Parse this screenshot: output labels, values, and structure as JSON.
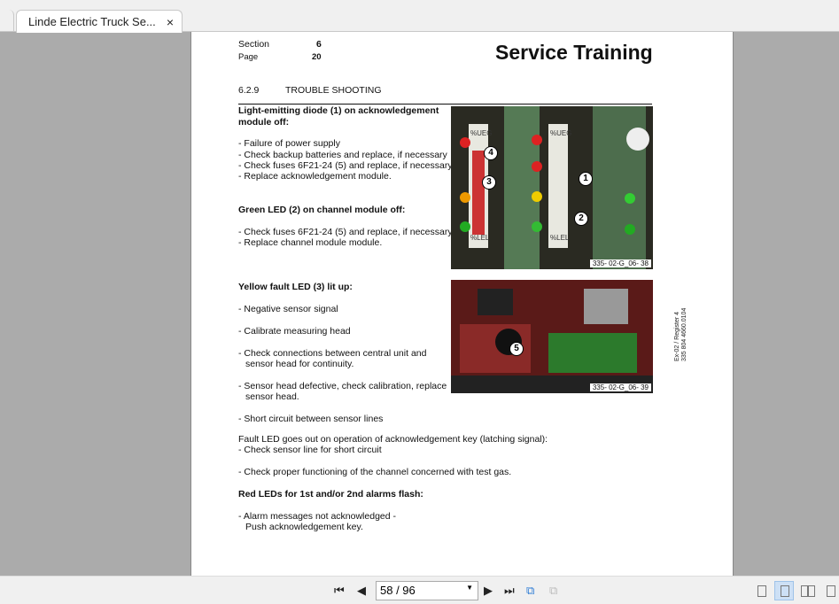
{
  "tab": {
    "title": "Linde Electric Truck Se...",
    "close": "×"
  },
  "header": {
    "section_label": "Section",
    "section_value": "6",
    "page_label": "Page",
    "page_value": "20",
    "title": "Service Training"
  },
  "heading": {
    "number": "6.2.9",
    "text": "TROUBLE  SHOOTING"
  },
  "blocks": [
    {
      "title": "Light-emitting diode (1) on acknowledgement",
      "title2": "module off:",
      "items": [
        "-  Failure of power supply",
        "-  Check backup batteries and replace, if necessary",
        "-  Check fuses 6F21-24 (5) and replace, if necessary",
        "-  Replace acknowledgement module."
      ]
    },
    {
      "title": "Green LED (2) on channel module off:",
      "items": [
        "-  Check fuses 6F21-24 (5) and replace, if necessary",
        "-  Replace channel module module."
      ]
    },
    {
      "title": "Yellow fault LED (3) lit up:",
      "items": [
        "-  Negative sensor signal",
        "-  Calibrate measuring head",
        "-  Check  connections  between  central  unit  and",
        "sensor head for continuity.",
        "-  Sensor head defective, check calibration, replace",
        "sensor head.",
        "-  Short circuit between sensor lines"
      ]
    },
    {
      "intro": "Fault LED goes out on operation of acknowledgement key (latching signal):",
      "items": [
        "-  Check sensor line for short circuit",
        "-  Check proper functioning of the channel concerned with test gas."
      ]
    },
    {
      "title": "Red LEDs for 1st and/or 2nd alarms flash:",
      "items": [
        "-  Alarm messages not acknowledged -",
        "Push acknowledgement key."
      ]
    }
  ],
  "photos": [
    {
      "caption": "335- 02-G_06- 38",
      "labels": [
        "%UEG",
        "%LEL",
        "%UEG",
        "%LEL"
      ],
      "callouts": [
        "4",
        "3",
        "1",
        "2"
      ]
    },
    {
      "caption": "335- 02-G_06- 39",
      "callouts": [
        "5"
      ]
    }
  ],
  "side_note": {
    "line1": "Ex-02 / Register 4",
    "line2": "335 804 4660.0104"
  },
  "toolbar": {
    "page_value": "58 / 96"
  }
}
